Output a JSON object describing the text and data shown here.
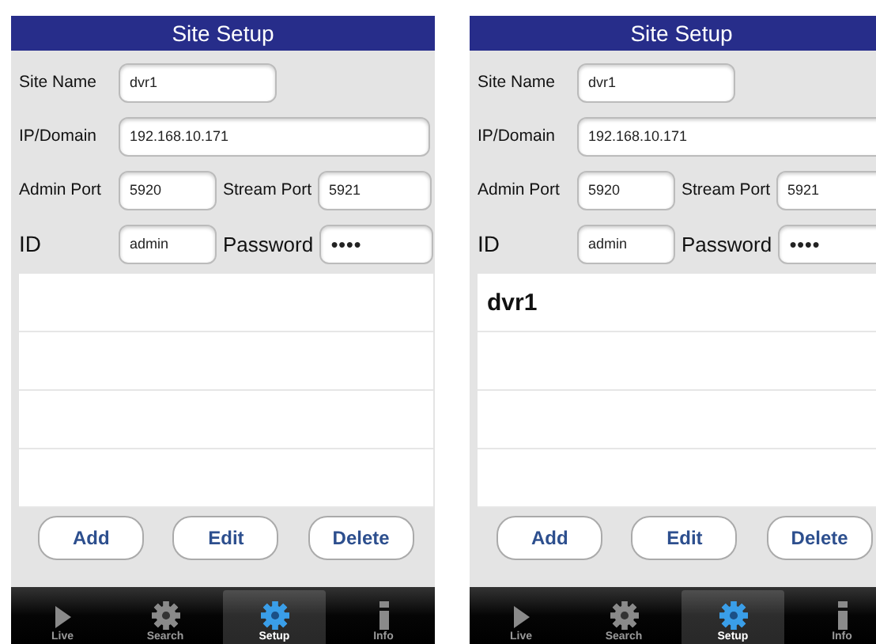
{
  "screens": [
    {
      "title": "Site Setup",
      "fields": {
        "site_name": {
          "label": "Site Name",
          "value": "dvr1"
        },
        "ip_domain": {
          "label": "IP/Domain",
          "value": "192.168.10.171"
        },
        "admin_port": {
          "label": "Admin Port",
          "value": "5920"
        },
        "stream_port": {
          "label": "Stream Port",
          "value": "5921"
        },
        "id": {
          "label": "ID",
          "value": "admin"
        },
        "password": {
          "label": "Password",
          "value": "●●●●"
        }
      },
      "buttons": [
        "Add",
        "Edit",
        "Delete"
      ],
      "tabs": [
        {
          "label": "Live",
          "kind": "play",
          "selected": false
        },
        {
          "label": "Search",
          "kind": "gear",
          "selected": false
        },
        {
          "label": "Setup",
          "kind": "gear",
          "selected": true
        },
        {
          "label": "Info",
          "kind": "info",
          "selected": false
        }
      ]
    },
    {
      "title": "Site Setup",
      "fields": {
        "site_name": {
          "label": "Site Name",
          "value": "dvr1"
        },
        "ip_domain": {
          "label": "IP/Domain",
          "value": "192.168.10.171"
        },
        "admin_port": {
          "label": "Admin Port",
          "value": "5920"
        },
        "stream_port": {
          "label": "Stream Port",
          "value": "5921"
        },
        "id": {
          "label": "ID",
          "value": "admin"
        },
        "password": {
          "label": "Password",
          "value": "●●●●"
        }
      },
      "sites": [
        "dvr1"
      ],
      "buttons": [
        "Add",
        "Edit",
        "Delete"
      ],
      "tabs": [
        {
          "label": "Live",
          "kind": "play",
          "selected": false
        },
        {
          "label": "Search",
          "kind": "gear",
          "selected": false
        },
        {
          "label": "Setup",
          "kind": "gear",
          "selected": true
        },
        {
          "label": "Info",
          "kind": "info",
          "selected": false
        }
      ]
    }
  ]
}
